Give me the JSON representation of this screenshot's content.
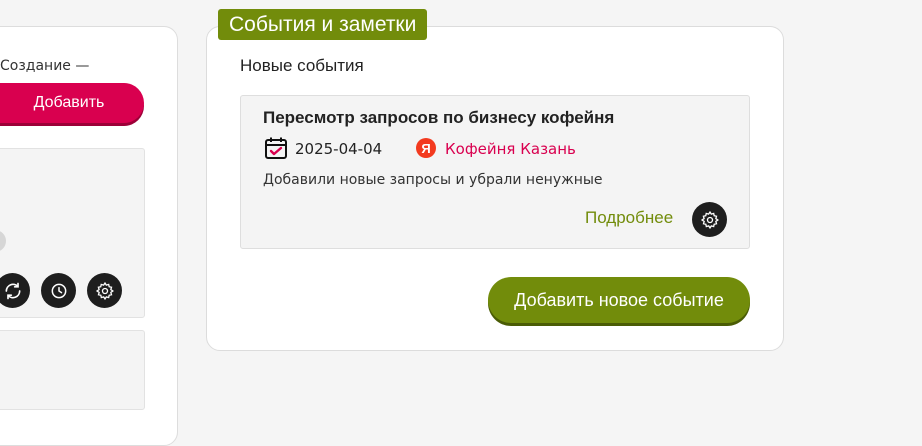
{
  "left_panel": {
    "create_text": "Создание —",
    "add_button": "Добавить",
    "icons": [
      "refresh-icon",
      "clock-icon",
      "gear-icon"
    ]
  },
  "events": {
    "section_tag": "События и заметки",
    "new_events_title": "Новые события",
    "items": [
      {
        "title": "Пересмотр запросов по бизнесу кофейня",
        "date": "2025-04-04",
        "place": "Кофейня Казань",
        "place_icon": "yandex-icon",
        "place_icon_glyph": "Я",
        "description": "Добавили новые запросы и убрали ненужные",
        "more_link": "Подробнее"
      }
    ],
    "add_button": "Добавить новое событие"
  },
  "colors": {
    "accent_green": "#728c0b",
    "accent_crimson": "#d9004f",
    "yandex_red": "#f33a1f",
    "icon_dark": "#1e1e1e"
  }
}
